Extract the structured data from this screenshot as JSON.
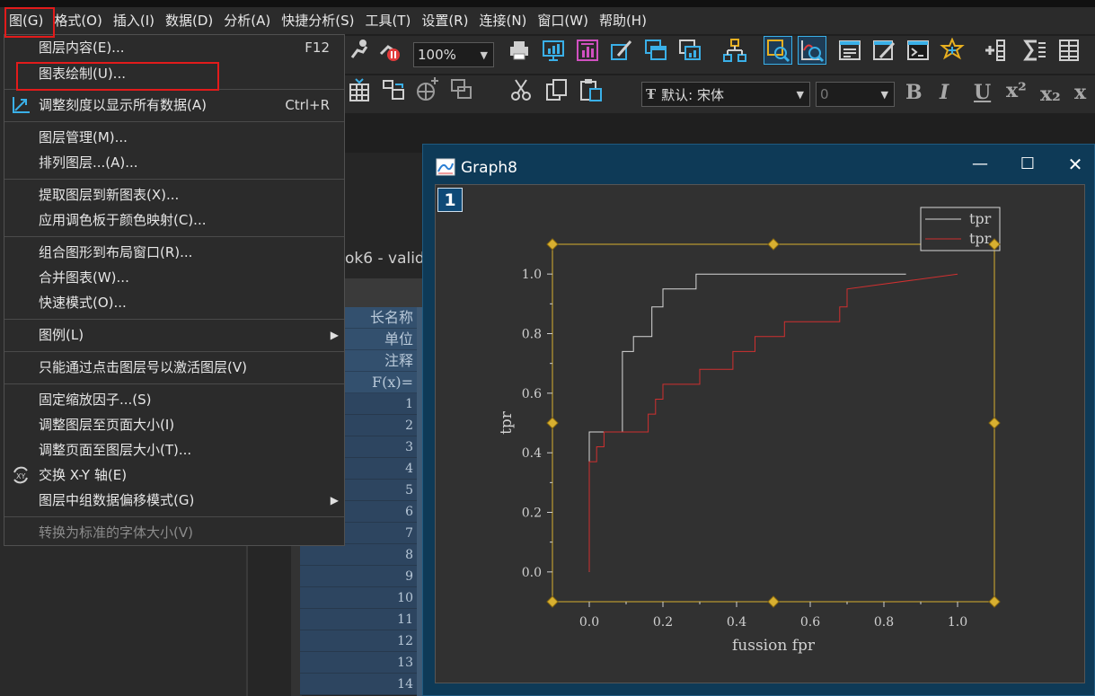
{
  "menubar": {
    "items": [
      "图(G)",
      "格式(O)",
      "插入(I)",
      "数据(D)",
      "分析(A)",
      "快捷分析(S)",
      "工具(T)",
      "设置(R)",
      "连接(N)",
      "窗口(W)",
      "帮助(H)"
    ]
  },
  "toolbar": {
    "zoom": "100%",
    "font_name": "默认: 宋体",
    "font_size": "0",
    "format_b": "B",
    "format_i": "I",
    "format_u": "U",
    "sup": "x²",
    "sub": "x₂"
  },
  "context_menu": {
    "items": [
      {
        "label": "图层内容(E)...",
        "shortcut": "F12"
      },
      {
        "label": "图表绘制(U)..."
      },
      {
        "label": "调整刻度以显示所有数据(A)",
        "shortcut": "Ctrl+R"
      },
      {
        "label": "图层管理(M)..."
      },
      {
        "label": "排列图层...(A)..."
      },
      {
        "label": "提取图层到新图表(X)..."
      },
      {
        "label": "应用调色板于颜色映射(C)..."
      },
      {
        "label": "组合图形到布局窗口(R)..."
      },
      {
        "label": "合并图表(W)..."
      },
      {
        "label": "快速模式(O)..."
      },
      {
        "label": "图例(L)"
      },
      {
        "label": "只能通过点击图层号以激活图层(V)"
      },
      {
        "label": "固定缩放因子...(S)"
      },
      {
        "label": "调整图层至页面大小(I)"
      },
      {
        "label": "调整页面至图层大小(T)..."
      },
      {
        "label": "交换 X-Y 轴(E)"
      },
      {
        "label": "图层中组数据偏移模式(G)"
      },
      {
        "label": "转换为标准的字体大小(V)"
      }
    ]
  },
  "workbook": {
    "title": "ok6 - valid",
    "headers": [
      "长名称",
      "单位",
      "注释",
      "F(x)="
    ],
    "rows": [
      "1",
      "2",
      "3",
      "4",
      "5",
      "6",
      "7",
      "8",
      "9",
      "10",
      "11",
      "12",
      "13",
      "14"
    ]
  },
  "graph_window": {
    "title": "Graph8",
    "layer_number": "1",
    "minimize": "—",
    "maximize": "☐",
    "close": "✕"
  },
  "chart_data": {
    "type": "line",
    "xlabel": "fussion fpr",
    "ylabel": "tpr",
    "xlim": [
      -0.1,
      1.1
    ],
    "ylim": [
      -0.1,
      1.1
    ],
    "xticks": [
      0.0,
      0.2,
      0.4,
      0.6,
      0.8,
      1.0
    ],
    "yticks": [
      0.0,
      0.2,
      0.4,
      0.6,
      0.8,
      1.0
    ],
    "xtick_labels": [
      "0.0",
      "0.2",
      "0.4",
      "0.6",
      "0.8",
      "1.0"
    ],
    "ytick_labels": [
      "0.0",
      "0.2",
      "0.4",
      "0.6",
      "0.8",
      "1.0"
    ],
    "legend_position": "top-right",
    "series": [
      {
        "name": "tpr",
        "color": "#d8d8d8",
        "x": [
          0.0,
          0.0,
          0.09,
          0.09,
          0.12,
          0.12,
          0.17,
          0.17,
          0.2,
          0.2,
          0.29,
          0.29,
          0.86,
          0.86
        ],
        "y": [
          0.0,
          0.47,
          0.47,
          0.74,
          0.74,
          0.79,
          0.79,
          0.89,
          0.89,
          0.95,
          0.95,
          1.0,
          1.0,
          1.0
        ]
      },
      {
        "name": "tpr",
        "color": "#d03030",
        "x": [
          0.0,
          0.0,
          0.02,
          0.02,
          0.04,
          0.04,
          0.16,
          0.16,
          0.18,
          0.18,
          0.2,
          0.2,
          0.3,
          0.3,
          0.39,
          0.39,
          0.45,
          0.45,
          0.53,
          0.53,
          0.68,
          0.68,
          0.7,
          0.7,
          1.0
        ],
        "y": [
          0.0,
          0.37,
          0.37,
          0.42,
          0.42,
          0.47,
          0.47,
          0.53,
          0.53,
          0.58,
          0.58,
          0.63,
          0.63,
          0.68,
          0.68,
          0.74,
          0.74,
          0.79,
          0.79,
          0.84,
          0.84,
          0.89,
          0.89,
          0.95,
          1.0
        ]
      }
    ],
    "colors": {
      "frame": "#d8b030",
      "axis": "#3a3ad0",
      "text": "#d0d0d0"
    }
  }
}
